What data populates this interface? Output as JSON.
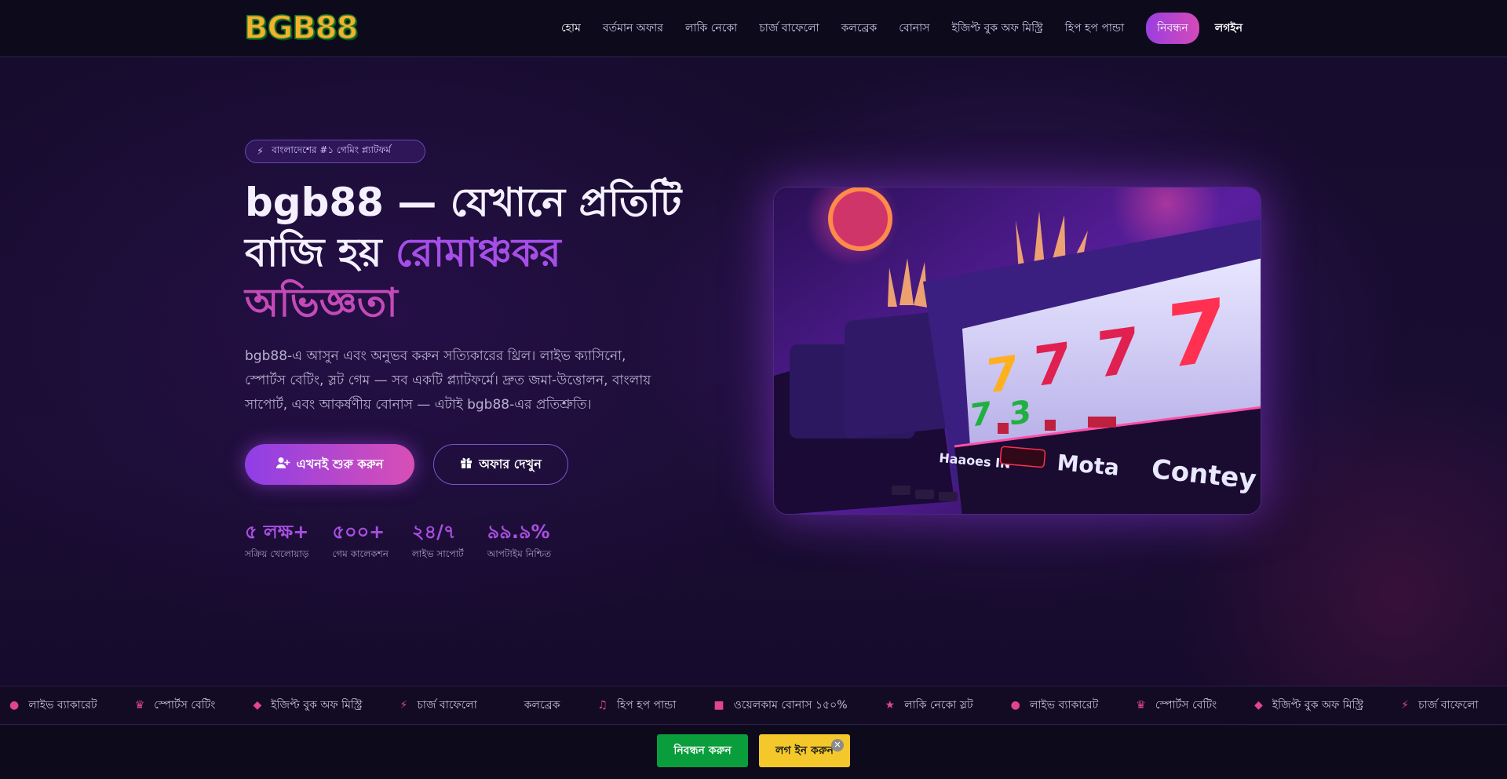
{
  "header": {
    "logo_text": "BGB88",
    "nav": [
      {
        "label": "হোম",
        "active": true
      },
      {
        "label": "বর্তমান অফার"
      },
      {
        "label": "লাকি নেকো"
      },
      {
        "label": "চার্জ বাফেলো"
      },
      {
        "label": "কলব্রেক"
      },
      {
        "label": "বোনাস"
      },
      {
        "label": "ইজিপ্ট বুক অফ মিস্ট্রি"
      },
      {
        "label": "হিপ হপ পান্ডা"
      }
    ],
    "register_label": "নিবন্ধন",
    "login_label": "লগইন"
  },
  "hero": {
    "badge_icon": "bolt-icon",
    "badge_text": "বাংলাদেশের #১ গেমিং প্ল্যাটফর্ম",
    "title_part1": "bgb88 — যেখানে প্রতিটি বাজি হয় ",
    "title_highlight1": "রোমাঞ্চকর",
    "title_highlight2": "অভিজ্ঞতা",
    "description": "bgb88-এ আসুন এবং অনুভব করুন সত্যিকারের থ্রিল। লাইভ ক্যাসিনো, স্পোর্টস বেটিং, স্লট গেম — সব একটি প্ল্যাটফর্মে। দ্রুত জমা-উত্তোলন, বাংলায় সাপোর্ট, এবং আকর্ষণীয় বোনাস — এটাই bgb88-এর প্রতিশ্রুতি।",
    "start_button": "এখনই শুরু করুন",
    "offer_button": "অফার দেখুন",
    "stats": [
      {
        "value": "৫ লক্ষ+",
        "label": "সক্রিয় খেলোয়াড়"
      },
      {
        "value": "৫০০+",
        "label": "গেম কালেকশন"
      },
      {
        "value": "২৪/৭",
        "label": "লাইভ সাপোর্ট"
      },
      {
        "value": "৯৯.৯%",
        "label": "আপটাইম নিশ্চিত"
      }
    ],
    "image_texts": [
      "Haaoes IN",
      "Mota",
      "Contey"
    ]
  },
  "ticker": [
    {
      "icon": "fire-icon",
      "glyph": "●",
      "label": "লাইভ ব্যাকারেট"
    },
    {
      "icon": "trophy-icon",
      "glyph": "♛",
      "label": "স্পোর্টস বেটিং"
    },
    {
      "icon": "gem-icon",
      "glyph": "◆",
      "label": "ইজিপ্ট বুক অফ মিস্ট্রি"
    },
    {
      "icon": "bolt-icon",
      "glyph": "⚡",
      "label": "চার্জ বাফেলো"
    },
    {
      "icon": "cards-icon",
      "glyph": "",
      "label": "কলব্রেক"
    },
    {
      "icon": "music-icon",
      "glyph": "♫",
      "label": "হিপ হপ পান্ডা"
    },
    {
      "icon": "gift-icon",
      "glyph": "■",
      "label": "ওয়েলকাম বোনাস ১৫০%"
    },
    {
      "icon": "star-icon",
      "glyph": "★",
      "label": "লাকি নেকো স্লট"
    },
    {
      "icon": "fire-icon",
      "glyph": "●",
      "label": "লাইভ ব্যাকারেট"
    },
    {
      "icon": "trophy-icon",
      "glyph": "♛",
      "label": "স্পোর্টস বেটিং"
    },
    {
      "icon": "gem-icon",
      "glyph": "◆",
      "label": "ইজিপ্ট বুক অফ মিস্ট্রি"
    },
    {
      "icon": "bolt-icon",
      "glyph": "⚡",
      "label": "চার্জ বাফেলো"
    }
  ],
  "bottombar": {
    "register_label": "নিবন্ধন করুন",
    "login_label": "লগ ইন করুন",
    "close_glyph": "✕"
  }
}
